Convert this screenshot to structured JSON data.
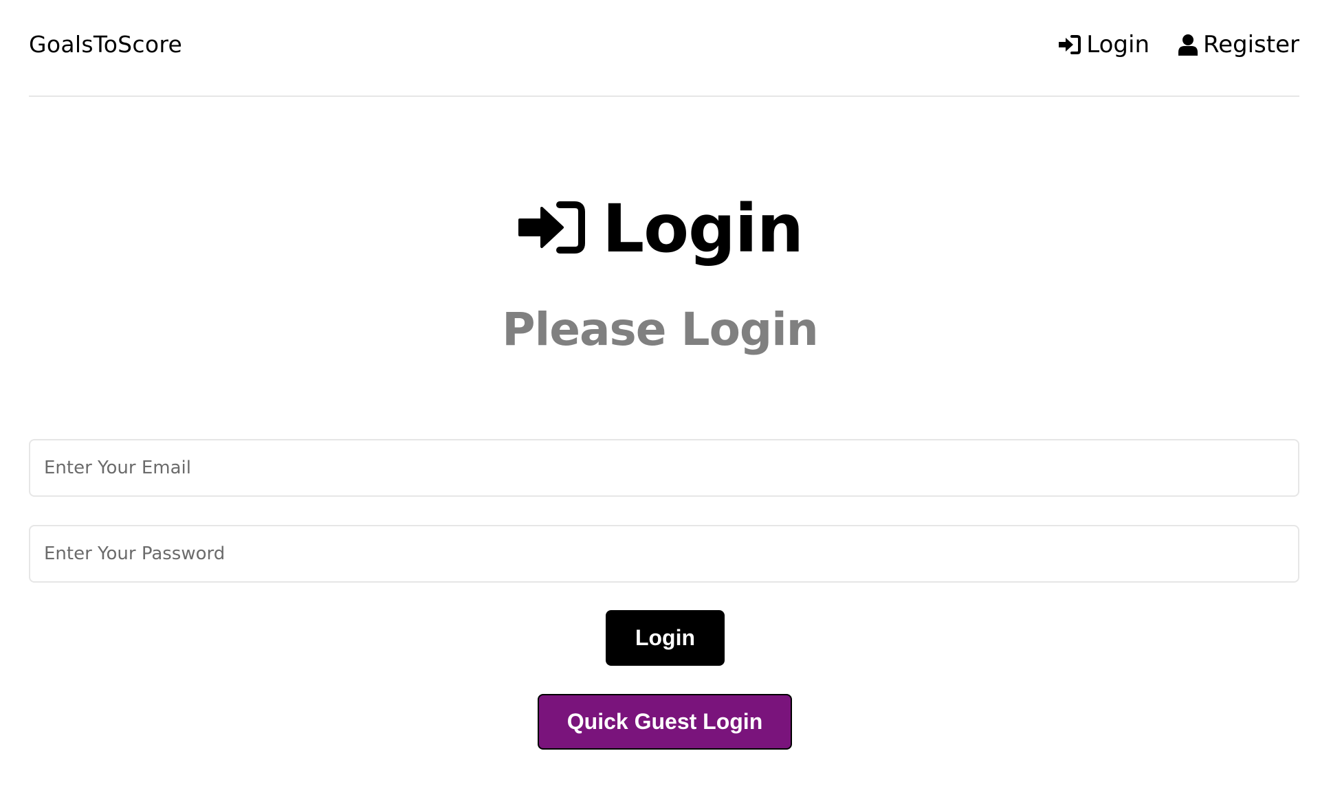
{
  "header": {
    "brand": "GoalsToScore",
    "nav": {
      "login_label": "Login",
      "register_label": "Register",
      "login_icon": "sign-in-icon",
      "register_icon": "user-icon"
    }
  },
  "main": {
    "title": "Login",
    "title_icon": "sign-in-icon",
    "subtitle": "Please Login",
    "email_placeholder": "Enter Your Email",
    "password_placeholder": "Enter Your Password",
    "login_button": "Login",
    "guest_button": "Quick Guest Login"
  },
  "colors": {
    "primary_button": "#000000",
    "guest_button": "#7a147c",
    "subtitle": "#808080",
    "divider": "#e6e6e6"
  }
}
